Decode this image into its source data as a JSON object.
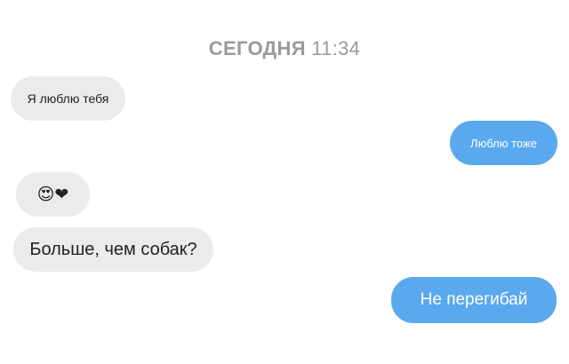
{
  "chat": {
    "timestamp": {
      "day": "СЕГОДНЯ",
      "time": "11:34"
    },
    "messages": [
      {
        "direction": "incoming",
        "text": "Я люблю тебя"
      },
      {
        "direction": "outgoing",
        "text": "Люблю тоже"
      },
      {
        "direction": "incoming",
        "emoji": [
          "smiling-face-with-heart-eyes",
          "black-heart"
        ],
        "text": "😍❤"
      },
      {
        "direction": "incoming",
        "text": "Больше, чем собак?"
      },
      {
        "direction": "outgoing",
        "text": "Не перегибай"
      }
    ]
  },
  "colors": {
    "incoming_bubble": "#ebebeb",
    "outgoing_bubble": "#5aa9ef",
    "timestamp": "#9a9a9a"
  }
}
